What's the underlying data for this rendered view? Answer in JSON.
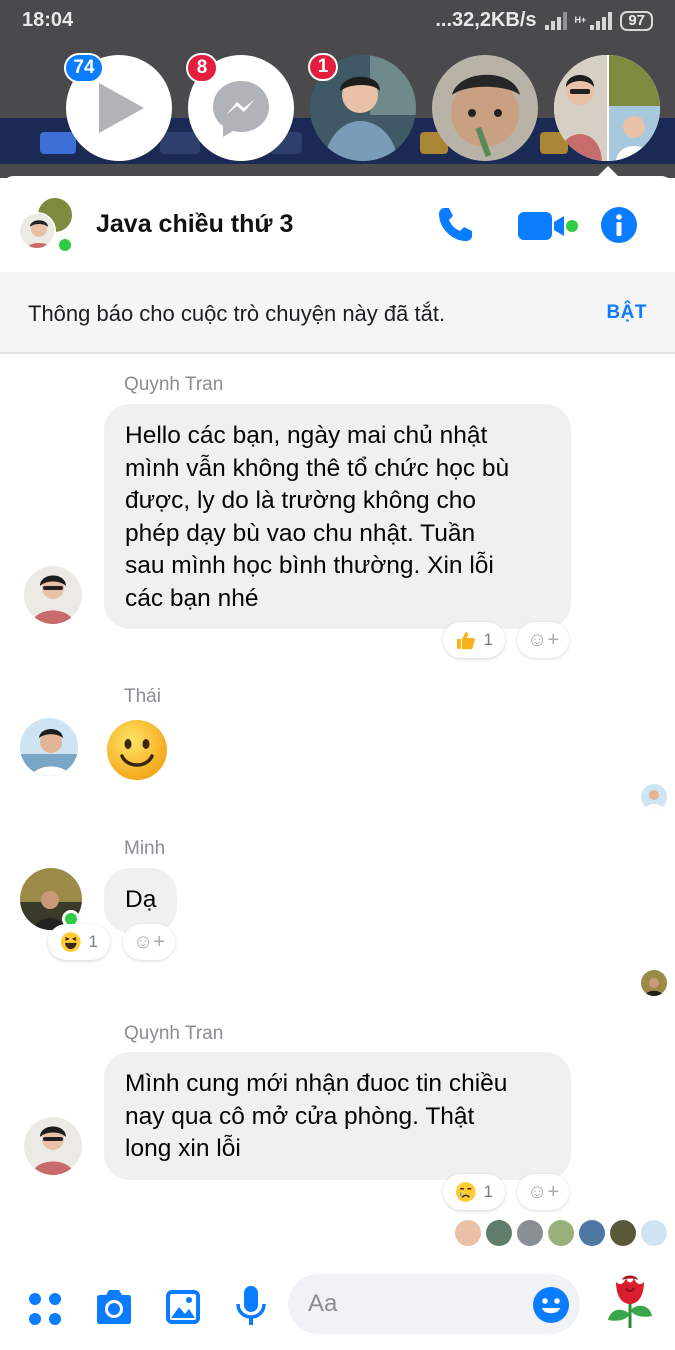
{
  "status_bar": {
    "time": "18:04",
    "network_speed": "...32,2KB/s",
    "network_type": "H+",
    "battery": "97"
  },
  "chat_heads": [
    {
      "kind": "video",
      "badge": "74"
    },
    {
      "kind": "messenger",
      "badge": "8"
    },
    {
      "kind": "person",
      "badge": "1"
    },
    {
      "kind": "person",
      "badge": ""
    },
    {
      "kind": "group",
      "badge": ""
    }
  ],
  "header": {
    "title": "Java chiều thứ 3",
    "icons": [
      "phone-icon",
      "video-call-icon",
      "info-icon"
    ]
  },
  "mute_notice": {
    "text": "Thông báo cho cuộc trò chuyện này đã tắt.",
    "action": "BẬT"
  },
  "messages": [
    {
      "sender": "Quynh Tran",
      "lines": [
        "Hello các bạn, ngày mai chủ nhật",
        "mình vẫn không thê tổ chức học bù",
        "được, ly do là trường không cho",
        "phép dạy bù vao chu nhật. Tuần",
        "sau mình học bình thường. Xin lỗi",
        "các bạn nhé"
      ],
      "reaction_icon": "thumbs-up-icon",
      "reaction_count": "1"
    },
    {
      "sender": "Thái",
      "sticker": "smiley-icon"
    },
    {
      "sender": "Minh",
      "text": "Dạ",
      "reaction_icon": "laughing-icon",
      "reaction_count": "1"
    },
    {
      "sender": "Quynh Tran",
      "lines": [
        "Mình cung mới nhận đuoc tin chiều",
        "nay qua cô mở cửa phòng. Thật",
        "long xin lỗi"
      ],
      "reaction_icon": "crying-icon",
      "reaction_count": "1"
    }
  ],
  "add_reaction_label": "☺+",
  "composer": {
    "placeholder": "Aa",
    "icons": [
      "apps-icon",
      "camera-icon",
      "gallery-icon",
      "mic-icon",
      "emoji-icon",
      "rose-icon"
    ]
  },
  "colors": {
    "accent": "#0a7cff",
    "badge_red": "#e41e3f",
    "online": "#31cc46",
    "bubble": "#f0f0f0"
  }
}
